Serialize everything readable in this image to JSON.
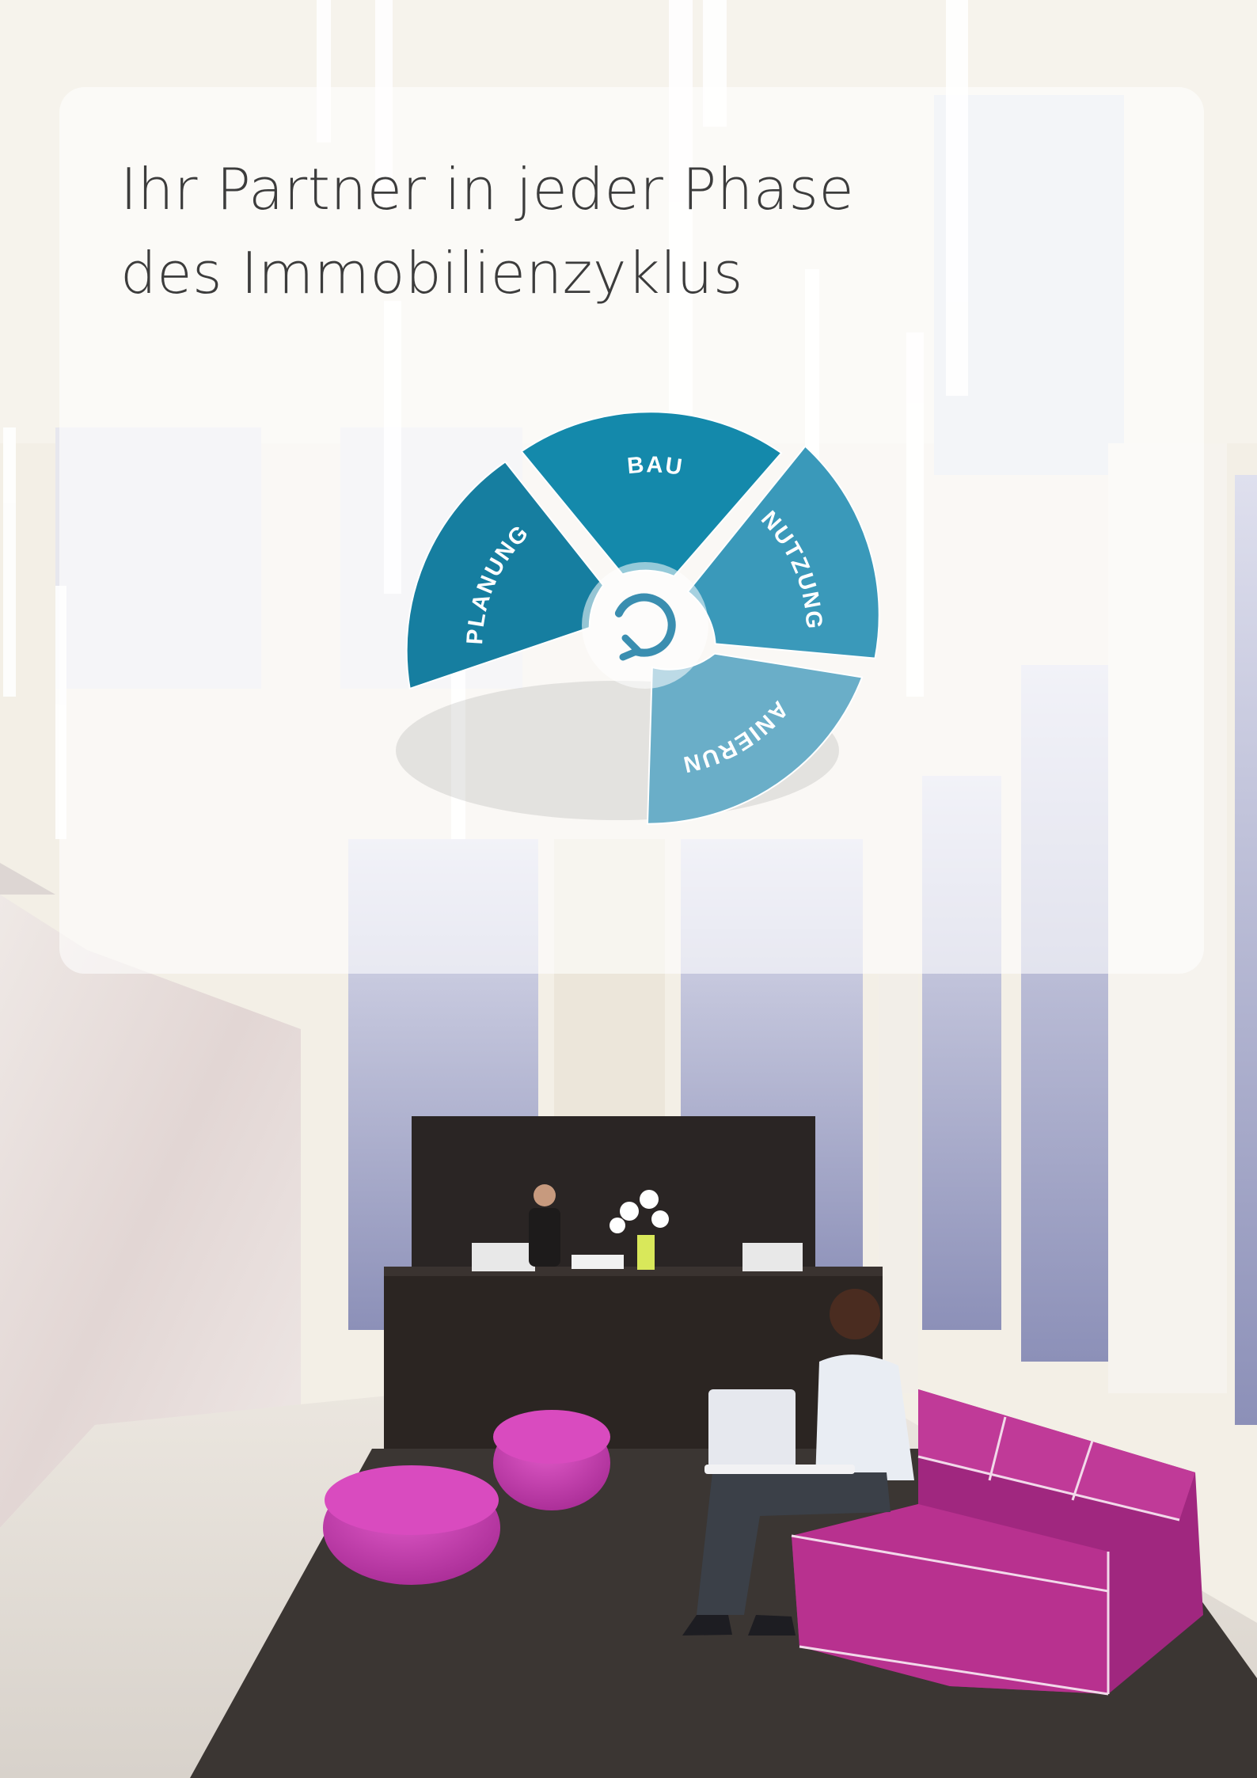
{
  "title": {
    "line1": "Ihr Partner in jeder Phase",
    "line2": "des Immobilienzyklus"
  },
  "cycle": {
    "center_icon": "refresh-cycle-icon",
    "segments": [
      {
        "label": "PLANUNG",
        "color": "#167ea0"
      },
      {
        "label": "BAU",
        "color": "#1489ab"
      },
      {
        "label": "NUTZUNG",
        "color": "#3a99ba"
      },
      {
        "label": "SANIERUNG",
        "color": "#6aaec8"
      }
    ]
  },
  "colors": {
    "title_text": "#3c3c3c",
    "accent_teal": "#1489ab",
    "sofa_magenta": "#b0288f",
    "desk_dark": "#2b2522"
  }
}
